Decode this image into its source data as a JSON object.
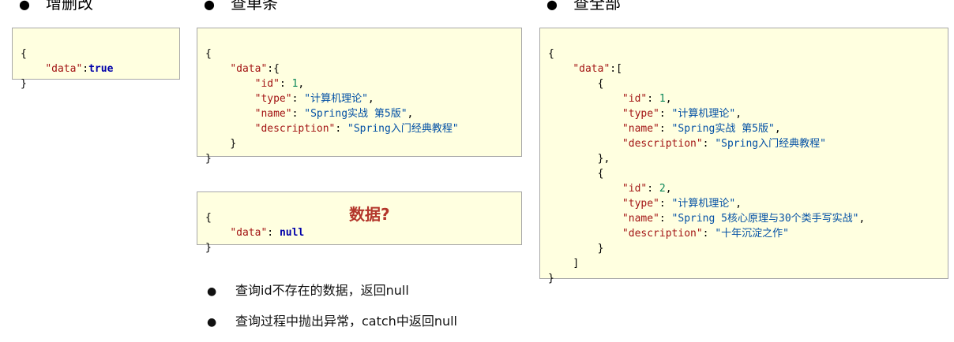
{
  "headings": {
    "write": "增删改",
    "single": "查单条",
    "all": "查全部"
  },
  "write_box": {
    "open": "{",
    "key": "\"data\"",
    "colon": ":",
    "value": "true",
    "close": "}"
  },
  "single_box": {
    "open": "{",
    "data_key": "\"data\"",
    "data_open": ":{",
    "fields": [
      {
        "key": "\"id\"",
        "sep": ": ",
        "value": "1",
        "end": ","
      },
      {
        "key": "\"type\"",
        "sep": ": ",
        "value": "\"计算机理论\"",
        "end": ","
      },
      {
        "key": "\"name\"",
        "sep": ": ",
        "value": "\"Spring实战 第5版\"",
        "end": ","
      },
      {
        "key": "\"description\"",
        "sep": ": ",
        "value": "\"Spring入门经典教程\"",
        "end": ""
      }
    ],
    "inner_close": "}",
    "close": "}"
  },
  "null_box": {
    "open": "{",
    "key": "\"data\"",
    "sep": ": ",
    "value": "null",
    "question": "数据?",
    "close": "}"
  },
  "all_box": {
    "open": "{",
    "data_key": "\"data\"",
    "data_open": ":[",
    "item1": {
      "open": "{",
      "fields": [
        {
          "key": "\"id\"",
          "sep": ": ",
          "value": "1",
          "end": ","
        },
        {
          "key": "\"type\"",
          "sep": ": ",
          "value": "\"计算机理论\"",
          "end": ","
        },
        {
          "key": "\"name\"",
          "sep": ": ",
          "value": "\"Spring实战 第5版\"",
          "end": ","
        },
        {
          "key": "\"description\"",
          "sep": ": ",
          "value": "\"Spring入门经典教程\"",
          "end": ""
        }
      ],
      "close": "},"
    },
    "item2": {
      "open": "{",
      "fields": [
        {
          "key": "\"id\"",
          "sep": ": ",
          "value": "2",
          "end": ","
        },
        {
          "key": "\"type\"",
          "sep": ": ",
          "value": "\"计算机理论\"",
          "end": ","
        },
        {
          "key": "\"name\"",
          "sep": ": ",
          "value": "\"Spring 5核心原理与30个类手写实战\"",
          "end": ","
        },
        {
          "key": "\"description\"",
          "sep": ": ",
          "value": "\"十年沉淀之作\"",
          "end": ""
        }
      ],
      "close": "}"
    },
    "array_close": "]",
    "close": "}"
  },
  "notes": [
    "查询id不存在的数据，返回null",
    "查询过程中抛出异常，catch中返回null"
  ],
  "colors": {
    "box_bg": "#ffffe0",
    "key": "#a31515",
    "string": "#0451a5",
    "number": "#098658",
    "keyword": "#0000aa",
    "question": "#b3362b"
  }
}
